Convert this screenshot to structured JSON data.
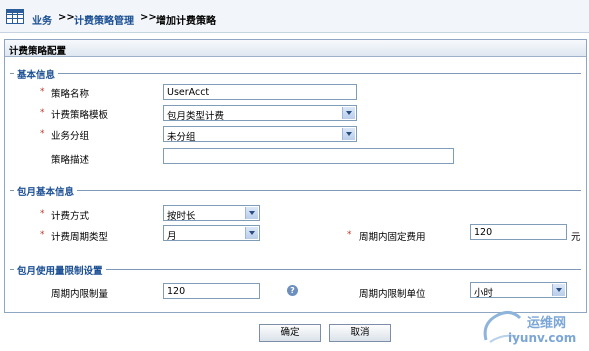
{
  "breadcrumb": {
    "items": [
      "业务",
      "计费策略管理",
      "增加计费策略"
    ],
    "separator": ">>"
  },
  "panel": {
    "title": "计费策略配置"
  },
  "basic": {
    "title": "基本信息",
    "name": {
      "label": "策略名称",
      "value": "UserAcct"
    },
    "template": {
      "label": "计费策略模板",
      "value": "包月类型计费"
    },
    "group": {
      "label": "业务分组",
      "value": "未分组"
    },
    "desc": {
      "label": "策略描述",
      "value": ""
    }
  },
  "monthly": {
    "title": "包月基本信息",
    "method": {
      "label": "计费方式",
      "value": "按时长"
    },
    "period_type": {
      "label": "计费周期类型",
      "value": "月"
    },
    "fixed_fee": {
      "label": "周期内固定费用",
      "value": "120",
      "unit": "元"
    }
  },
  "usage": {
    "title": "包月使用量限制设置",
    "limit": {
      "label": "周期内限制量",
      "value": "120"
    },
    "limit_unit": {
      "label": "周期内限制单位",
      "value": "小时"
    }
  },
  "buttons": {
    "ok": "确定",
    "cancel": "取消"
  },
  "watermark": {
    "cn": "运维网",
    "url": "iyunv.com"
  },
  "colors": {
    "link": "#1b4f93",
    "border": "#7f9db9",
    "required": "#c0392b"
  }
}
